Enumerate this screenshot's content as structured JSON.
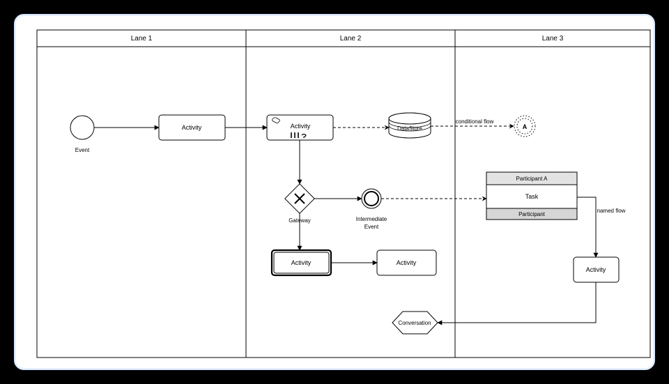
{
  "diagram": {
    "type": "BPMN",
    "pool": {
      "lanes": [
        {
          "id": "lane1",
          "title": "Lane 1"
        },
        {
          "id": "lane2",
          "title": "Lane 2"
        },
        {
          "id": "lane3",
          "title": "Lane 3"
        }
      ]
    },
    "nodes": {
      "event_start": {
        "lane": "lane1",
        "type": "start-event",
        "label": "Event"
      },
      "activity_a": {
        "lane": "lane1",
        "type": "task",
        "label": "Activity"
      },
      "activity_b": {
        "lane": "lane2",
        "type": "task-manual-loop",
        "label": "Activity"
      },
      "datastore": {
        "lane": "lane2",
        "type": "data-store",
        "label": "DataStore"
      },
      "target_a": {
        "lane": "lane3",
        "type": "compensation-catch",
        "label": "A"
      },
      "gateway": {
        "lane": "lane2",
        "type": "exclusive-gateway",
        "label": "Gateway"
      },
      "intermediate_event": {
        "lane": "lane2",
        "type": "intermediate-event",
        "label": "Intermediate Event"
      },
      "participant": {
        "lane": "lane3",
        "type": "participant",
        "header": "Participant A",
        "body": "Task",
        "footer": "Participant"
      },
      "activity_c": {
        "lane": "lane2",
        "type": "transaction",
        "label": "Activity"
      },
      "activity_d": {
        "lane": "lane2",
        "type": "task",
        "label": "Activity"
      },
      "activity_e": {
        "lane": "lane3",
        "type": "task",
        "label": "Activity"
      },
      "conversation": {
        "lane": "lane2",
        "type": "conversation",
        "label": "Conversation"
      }
    },
    "flows": [
      {
        "from": "event_start",
        "to": "activity_a",
        "style": "sequence"
      },
      {
        "from": "activity_a",
        "to": "activity_b",
        "style": "sequence"
      },
      {
        "from": "activity_b",
        "to": "datastore",
        "style": "message"
      },
      {
        "from": "datastore",
        "to": "target_a",
        "style": "message",
        "label": "conditional flow"
      },
      {
        "from": "activity_b",
        "to": "gateway",
        "style": "sequence"
      },
      {
        "from": "gateway",
        "to": "intermediate_event",
        "style": "sequence"
      },
      {
        "from": "intermediate_event",
        "to": "participant",
        "style": "message"
      },
      {
        "from": "gateway",
        "to": "activity_c",
        "style": "sequence"
      },
      {
        "from": "activity_c",
        "to": "activity_d",
        "style": "sequence"
      },
      {
        "from": "participant",
        "to": "activity_e",
        "style": "sequence",
        "label": "named flow"
      },
      {
        "from": "activity_e",
        "to": "conversation",
        "style": "sequence"
      }
    ]
  },
  "labels": {
    "conditional_flow": "conditional flow",
    "named_flow": "named flow",
    "intermediate_event_line2": "Event"
  }
}
